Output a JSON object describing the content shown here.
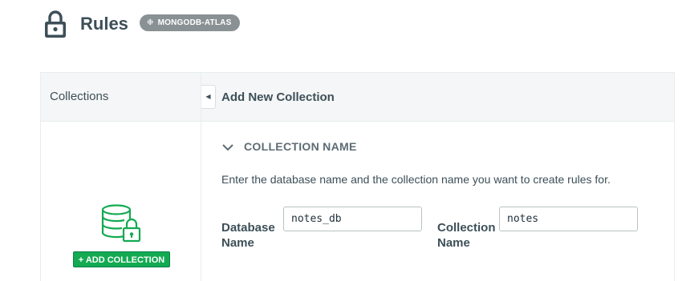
{
  "header": {
    "title": "Rules",
    "badge": "MONGODB-ATLAS",
    "icons": {
      "page": "lock-icon",
      "badge": "leaf-icon"
    }
  },
  "sidebar": {
    "title": "Collections",
    "add_button_label": "+ ADD COLLECTION",
    "icon": "database-lock-icon"
  },
  "main": {
    "title": "Add New Collection",
    "section_title": "COLLECTION NAME",
    "instructions": "Enter the database name and the collection name you want to create rules for.",
    "fields": {
      "database": {
        "label_line1": "Database",
        "label_line2": "Name",
        "value": "notes_db"
      },
      "collection": {
        "label_line1": "Collection",
        "label_line2": "Name",
        "value": "notes"
      }
    }
  },
  "colors": {
    "accent": "#13aa52",
    "badge": "#8a9195",
    "text": "#3d4f58",
    "panel_header": "#f5f6f7"
  }
}
